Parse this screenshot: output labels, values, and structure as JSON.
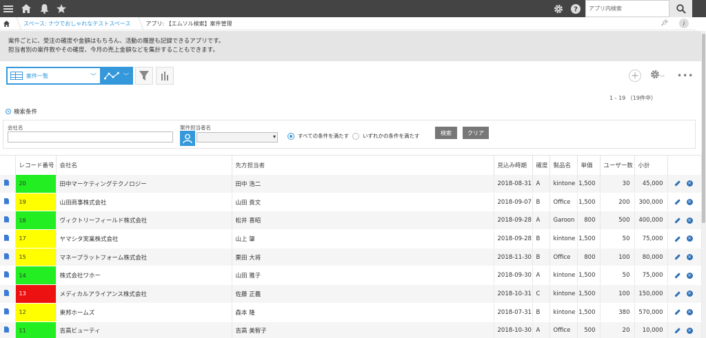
{
  "colors": {
    "accent": "#3498db",
    "topbar": "#444444",
    "green": "#22ee22",
    "yellow": "#ffff00",
    "red": "#ee1111"
  },
  "topbar": {
    "search_placeholder": "アプリ内検索",
    "icons": [
      "menu-icon",
      "home-icon",
      "bell-icon",
      "star-icon",
      "gear-icon",
      "help-icon",
      "search-icon"
    ]
  },
  "breadcrumb": {
    "space": "スペース: ナウでおしゃれなテストスペース",
    "app": "アプリ: 【エムソル検索】案件管理"
  },
  "description": {
    "line1": "案件ごとに、受注の確度や金額はもちろん、活動の履歴も記録できるアプリです。",
    "line2": "担当者別の案件数やその確度、今月の売上金額などを集計することもできます。"
  },
  "toolbar": {
    "view_label": "案件一覧",
    "record_count": "1 - 19 （19件中）"
  },
  "search": {
    "toggle_label": "検索条件",
    "company_label": "会社名",
    "company_value": "",
    "owner_label": "案件担当者名",
    "owner_value": "",
    "radio_all": "すべての条件を満たす",
    "radio_any": "いずれかの条件を満たす",
    "search_button": "検索",
    "clear_button": "クリア"
  },
  "table": {
    "headers": {
      "record": "レコード番号",
      "company": "会社名",
      "contact": "先方担当者",
      "date": "見込み時期",
      "probability": "確度",
      "product": "製品名",
      "unit_price": "単価",
      "users": "ユーザー数",
      "subtotal": "小計"
    },
    "rows": [
      {
        "record": "20",
        "status": "green",
        "company": "田中マーケティングテクノロジー",
        "contact": "田中 浩二",
        "date": "2018-08-31",
        "probability": "A",
        "product": "kintone",
        "unit_price": "1,500",
        "users": "30",
        "subtotal": "45,000"
      },
      {
        "record": "19",
        "status": "yellow",
        "company": "山田商事株式会社",
        "contact": "山田 貴文",
        "date": "2018-09-07",
        "probability": "B",
        "product": "Office",
        "unit_price": "1,500",
        "users": "200",
        "subtotal": "300,000"
      },
      {
        "record": "18",
        "status": "green",
        "company": "ヴィクトリーフィールド株式会社",
        "contact": "松井 喜昭",
        "date": "2018-09-28",
        "probability": "A",
        "product": "Garoon",
        "unit_price": "800",
        "users": "500",
        "subtotal": "400,000"
      },
      {
        "record": "17",
        "status": "yellow",
        "company": "ヤマシタ実業株式会社",
        "contact": "山上 肇",
        "date": "2018-09-28",
        "probability": "B",
        "product": "kintone",
        "unit_price": "1,500",
        "users": "50",
        "subtotal": "75,000"
      },
      {
        "record": "15",
        "status": "yellow",
        "company": "マネープラットフォーム株式会社",
        "contact": "栗田 大将",
        "date": "2018-11-30",
        "probability": "B",
        "product": "Office",
        "unit_price": "800",
        "users": "100",
        "subtotal": "80,000"
      },
      {
        "record": "14",
        "status": "green",
        "company": "株式会社ワホー",
        "contact": "山田 雅子",
        "date": "2018-09-30",
        "probability": "A",
        "product": "kintone",
        "unit_price": "1,500",
        "users": "50",
        "subtotal": "75,000"
      },
      {
        "record": "13",
        "status": "red",
        "company": "メディカルアライアンス株式会社",
        "contact": "佐藤 正義",
        "date": "2018-10-31",
        "probability": "C",
        "product": "kintone",
        "unit_price": "1,500",
        "users": "100",
        "subtotal": "150,000"
      },
      {
        "record": "12",
        "status": "yellow",
        "company": "東邦ホームズ",
        "contact": "森本 隆",
        "date": "2018-07-31",
        "probability": "B",
        "product": "kintone",
        "unit_price": "1,500",
        "users": "380",
        "subtotal": "570,000"
      },
      {
        "record": "11",
        "status": "green",
        "company": "吉高ビューティ",
        "contact": "吉高 美智子",
        "date": "2018-10-30",
        "probability": "A",
        "product": "Office",
        "unit_price": "500",
        "users": "20",
        "subtotal": "10,000"
      }
    ]
  }
}
